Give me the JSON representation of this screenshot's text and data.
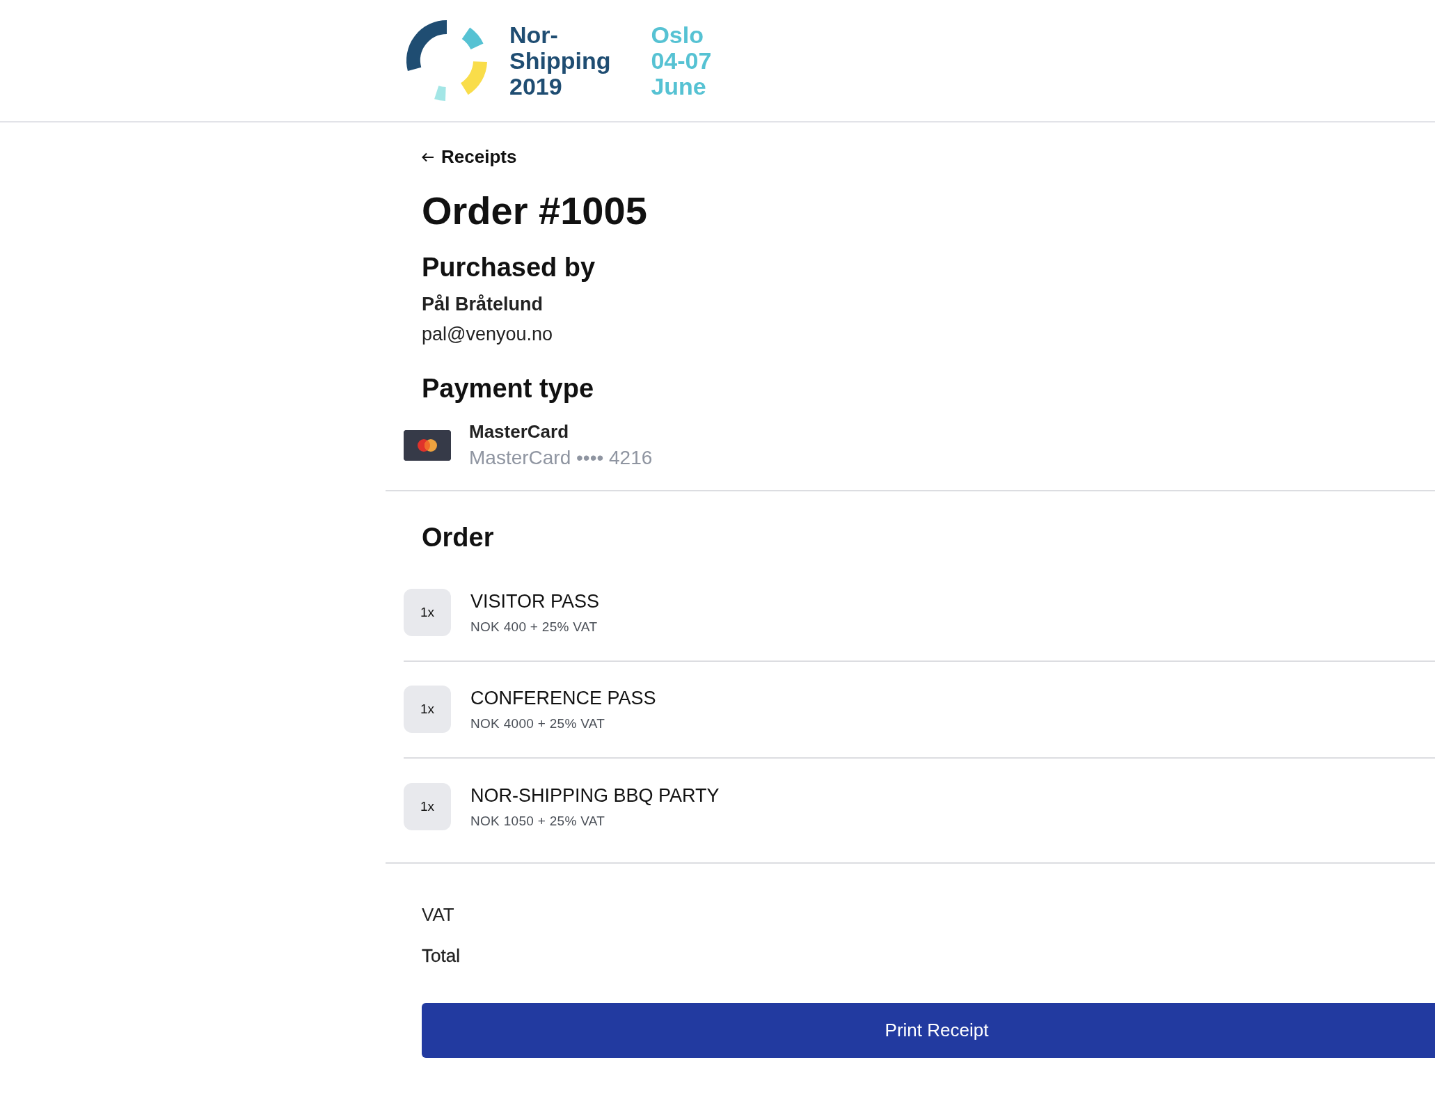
{
  "logo": {
    "name_lines": [
      "Nor-",
      "Shipping",
      "2019"
    ],
    "place_lines": [
      "Oslo",
      "04-07",
      "June"
    ]
  },
  "back_link": {
    "label": "Receipts"
  },
  "title": "Order #1005",
  "purchaser": {
    "heading": "Purchased by",
    "name": "Pål Bråtelund",
    "email": "pal@venyou.no"
  },
  "payment": {
    "heading": "Payment type",
    "card_name": "MasterCard",
    "card_detail": "MasterCard •••• 4216"
  },
  "order": {
    "heading": "Order",
    "items": [
      {
        "quantity": "1x",
        "name": "VISITOR PASS",
        "price": "NOK 400 + 25% VAT"
      },
      {
        "quantity": "1x",
        "name": "CONFERENCE PASS",
        "price": "NOK 4000 + 25% VAT"
      },
      {
        "quantity": "1x",
        "name": "NOR-SHIPPING BBQ PARTY",
        "price": "NOK 1050 + 25% VAT"
      }
    ]
  },
  "summary": {
    "vat_label": "VAT",
    "total_label": "Total"
  },
  "print_button": {
    "label": "Print Receipt"
  }
}
